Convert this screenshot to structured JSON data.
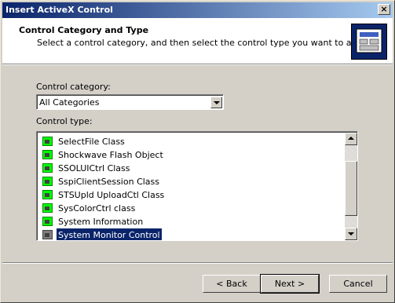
{
  "window": {
    "title": "Insert ActiveX Control",
    "close_glyph": "×"
  },
  "header": {
    "title": "Control Category and Type",
    "subtitle": "Select a control category, and then select the control type you want to add.",
    "icon": "wizard-toolbox-icon"
  },
  "category": {
    "label": "Control category:",
    "selected": "All Categories"
  },
  "control_type": {
    "label": "Control type:",
    "items": [
      {
        "label": "SelectFile Class",
        "selected": false
      },
      {
        "label": "Shockwave Flash Object",
        "selected": false
      },
      {
        "label": "SSOLUICtrl Class",
        "selected": false
      },
      {
        "label": "SspiClientSession Class",
        "selected": false
      },
      {
        "label": "STSUpld UploadCtl Class",
        "selected": false
      },
      {
        "label": "SysColorCtrl class",
        "selected": false
      },
      {
        "label": "System Information",
        "selected": false
      },
      {
        "label": "System Monitor Control",
        "selected": true
      }
    ],
    "item_icon": "activex-control-icon"
  },
  "buttons": {
    "back": "< Back",
    "next": "Next >",
    "cancel": "Cancel"
  },
  "colors": {
    "title_bar": "#0a246a",
    "selection": "#0a246a",
    "dialog_face": "#d4d0c8"
  }
}
